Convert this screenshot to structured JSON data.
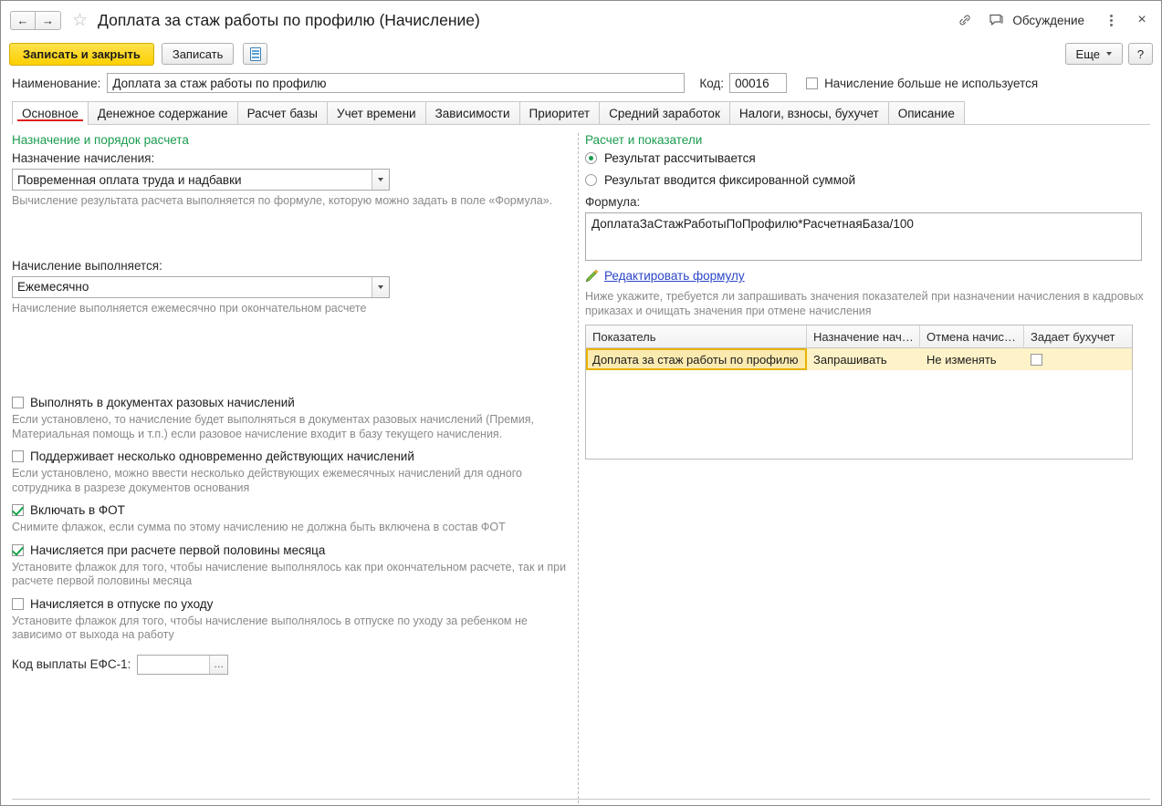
{
  "window": {
    "title": "Доплата за стаж работы по профилю (Начисление)",
    "back_icon": "←",
    "forward_icon": "→",
    "favorite_icon": "☆",
    "link_icon": "link-icon",
    "discussion_label": "Обсуждение",
    "more_icon": "kebab-icon",
    "close_icon": "×"
  },
  "commandbar": {
    "save_and_close": "Записать и закрыть",
    "save": "Записать",
    "journal_icon": "journal-icon",
    "more": "Еще",
    "help": "?"
  },
  "header_form": {
    "name_label": "Наименование:",
    "name_value": "Доплата за стаж работы по профилю",
    "code_label": "Код:",
    "code_value": "00016",
    "not_used_label": "Начисление больше не используется",
    "not_used_checked": false
  },
  "tabs": [
    {
      "label": "Основное",
      "active": true
    },
    {
      "label": "Денежное содержание",
      "active": false
    },
    {
      "label": "Расчет базы",
      "active": false
    },
    {
      "label": "Учет времени",
      "active": false
    },
    {
      "label": "Зависимости",
      "active": false
    },
    {
      "label": "Приоритет",
      "active": false
    },
    {
      "label": "Средний заработок",
      "active": false
    },
    {
      "label": "Налоги, взносы, бухучет",
      "active": false
    },
    {
      "label": "Описание",
      "active": false
    }
  ],
  "left": {
    "section_title": "Назначение и порядок расчета",
    "purpose_label": "Назначение начисления:",
    "purpose_value": "Повременная оплата труда и надбавки",
    "purpose_hint": "Вычисление результата расчета выполняется по формуле, которую можно задать в поле «Формула».",
    "performed_label": "Начисление выполняется:",
    "performed_value": "Ежемесячно",
    "performed_hint": "Начисление выполняется ежемесячно при окончательном расчете",
    "checks": [
      {
        "label": "Выполнять в документах разовых начислений",
        "checked": false,
        "hint": "Если установлено, то начисление будет выполняться в документах разовых начислений (Премия, Материальная помощь и т.п.) если разовое начисление входит в базу текущего начисления."
      },
      {
        "label": "Поддерживает несколько одновременно действующих начислений",
        "checked": false,
        "hint": "Если установлено, можно ввести несколько действующих ежемесячных начислений для одного сотрудника в разрезе документов основания"
      },
      {
        "label": "Включать в ФОТ",
        "checked": true,
        "hint": "Снимите флажок, если сумма по этому начислению не должна быть включена в состав ФОТ"
      },
      {
        "label": "Начисляется при расчете первой половины месяца",
        "checked": true,
        "hint": "Установите флажок для того, чтобы начисление выполнялось как при окончательном расчете, так и при расчете первой половины месяца"
      },
      {
        "label": "Начисляется в отпуске по уходу",
        "checked": false,
        "hint": "Установите флажок для того, чтобы начисление выполнялось в отпуске по уходу за ребенком не зависимо от выхода на работу"
      }
    ],
    "efs_label": "Код выплаты ЕФС-1:",
    "efs_value": "",
    "efs_pick_icon": "..."
  },
  "right": {
    "section_title": "Расчет и показатели",
    "radio_calculated": "Результат рассчитывается",
    "radio_fixed": "Результат вводится фиксированной суммой",
    "radio_selected": "calculated",
    "formula_label": "Формула:",
    "formula_value": "ДоплатаЗаСтажРаботыПоПрофилю*РасчетнаяБаза/100",
    "edit_formula_link": "Редактировать формулу",
    "pencil_icon": "pencil-icon",
    "grid_hint": "Ниже укажите, требуется ли запрашивать значения показателей при назначении начисления в кадровых приказах и очищать значения при отмене начисления",
    "grid": {
      "columns": [
        "Показатель",
        "Назначение нач…",
        "Отмена начис…",
        "Задает бухучет"
      ],
      "rows": [
        {
          "indicator": "Доплата за стаж работы по профилю",
          "assignment": "Запрашивать",
          "cancel": "Не изменять",
          "sets_accounting": false
        }
      ]
    }
  },
  "colors": {
    "accent_yellow": "#fcd000",
    "section_green": "#1a9c4e",
    "active_tab_underline": "#e02020",
    "link_blue": "#2b46c8",
    "row_highlight": "#fdf2c8"
  }
}
